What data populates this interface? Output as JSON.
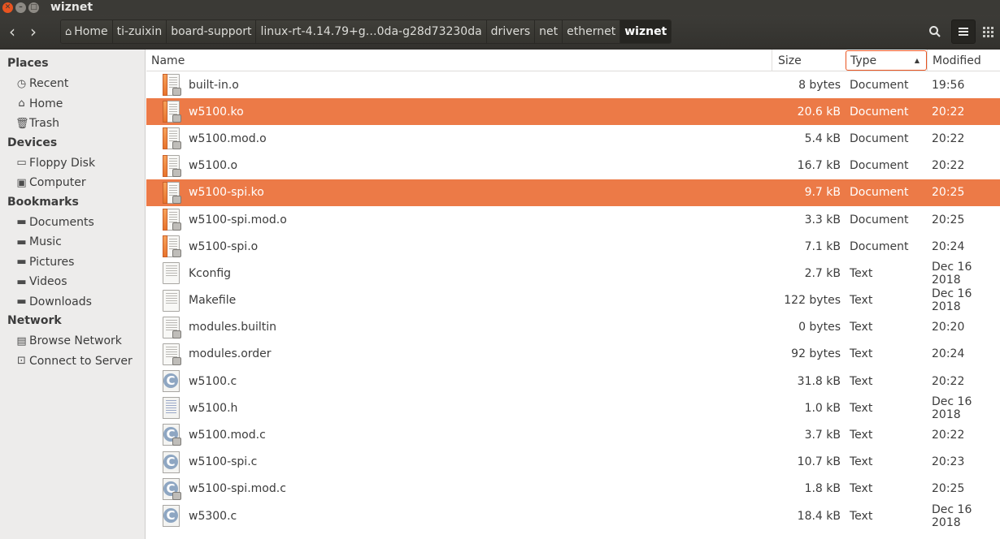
{
  "window": {
    "title": "wiznet"
  },
  "toolbar": {
    "breadcrumbs": [
      "Home",
      "ti-zuixin",
      "board-support",
      "linux-rt-4.14.79+g…0da-g28d73230da",
      "drivers",
      "net",
      "ethernet",
      "wiznet"
    ]
  },
  "sidebar": {
    "sections": [
      {
        "title": "Places",
        "items": [
          {
            "label": "Recent",
            "icon": "clock-icon"
          },
          {
            "label": "Home",
            "icon": "home-icon"
          },
          {
            "label": "Trash",
            "icon": "trash-icon"
          }
        ]
      },
      {
        "title": "Devices",
        "items": [
          {
            "label": "Floppy Disk",
            "icon": "drive-icon"
          },
          {
            "label": "Computer",
            "icon": "computer-icon"
          }
        ]
      },
      {
        "title": "Bookmarks",
        "items": [
          {
            "label": "Documents",
            "icon": "folder-icon"
          },
          {
            "label": "Music",
            "icon": "folder-icon"
          },
          {
            "label": "Pictures",
            "icon": "folder-icon"
          },
          {
            "label": "Videos",
            "icon": "folder-icon"
          },
          {
            "label": "Downloads",
            "icon": "folder-icon"
          }
        ]
      },
      {
        "title": "Network",
        "items": [
          {
            "label": "Browse Network",
            "icon": "network-icon"
          },
          {
            "label": "Connect to Server",
            "icon": "server-icon"
          }
        ]
      }
    ]
  },
  "list": {
    "columns": {
      "name": "Name",
      "size": "Size",
      "type": "Type",
      "modified": "Modified"
    },
    "files": [
      {
        "name": "built-in.o",
        "size": "8 bytes",
        "type": "Document",
        "modified": "19:56",
        "icon": "doc",
        "selected": false
      },
      {
        "name": "w5100.ko",
        "size": "20.6 kB",
        "type": "Document",
        "modified": "20:22",
        "icon": "doc",
        "selected": true
      },
      {
        "name": "w5100.mod.o",
        "size": "5.4 kB",
        "type": "Document",
        "modified": "20:22",
        "icon": "doc",
        "selected": false
      },
      {
        "name": "w5100.o",
        "size": "16.7 kB",
        "type": "Document",
        "modified": "20:22",
        "icon": "doc",
        "selected": false
      },
      {
        "name": "w5100-spi.ko",
        "size": "9.7 kB",
        "type": "Document",
        "modified": "20:25",
        "icon": "doc",
        "selected": true
      },
      {
        "name": "w5100-spi.mod.o",
        "size": "3.3 kB",
        "type": "Document",
        "modified": "20:25",
        "icon": "doc",
        "selected": false
      },
      {
        "name": "w5100-spi.o",
        "size": "7.1 kB",
        "type": "Document",
        "modified": "20:24",
        "icon": "doc",
        "selected": false
      },
      {
        "name": "Kconfig",
        "size": "2.7 kB",
        "type": "Text",
        "modified": "Dec 16 2018",
        "icon": "text",
        "selected": false
      },
      {
        "name": "Makefile",
        "size": "122 bytes",
        "type": "Text",
        "modified": "Dec 16 2018",
        "icon": "text",
        "selected": false
      },
      {
        "name": "modules.builtin",
        "size": "0 bytes",
        "type": "Text",
        "modified": "20:20",
        "icon": "text-lock",
        "selected": false
      },
      {
        "name": "modules.order",
        "size": "92 bytes",
        "type": "Text",
        "modified": "20:24",
        "icon": "text-lock",
        "selected": false
      },
      {
        "name": "w5100.c",
        "size": "31.8 kB",
        "type": "Text",
        "modified": "20:22",
        "icon": "c",
        "selected": false
      },
      {
        "name": "w5100.h",
        "size": "1.0 kB",
        "type": "Text",
        "modified": "Dec 16 2018",
        "icon": "h",
        "selected": false
      },
      {
        "name": "w5100.mod.c",
        "size": "3.7 kB",
        "type": "Text",
        "modified": "20:22",
        "icon": "c-lock",
        "selected": false
      },
      {
        "name": "w5100-spi.c",
        "size": "10.7 kB",
        "type": "Text",
        "modified": "20:23",
        "icon": "c",
        "selected": false
      },
      {
        "name": "w5100-spi.mod.c",
        "size": "1.8 kB",
        "type": "Text",
        "modified": "20:25",
        "icon": "c-lock",
        "selected": false
      },
      {
        "name": "w5300.c",
        "size": "18.4 kB",
        "type": "Text",
        "modified": "Dec 16 2018",
        "icon": "c",
        "selected": false
      }
    ]
  },
  "colors": {
    "accent": "#e95420",
    "selection": "#ec7a47",
    "titlebar": "#3b3a36"
  }
}
